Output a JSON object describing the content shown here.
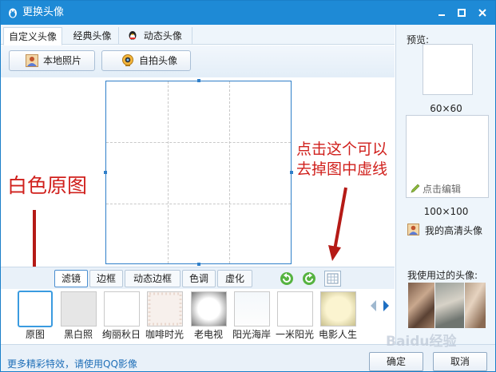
{
  "window": {
    "title": "更换头像",
    "controls": [
      "minimize",
      "maximize",
      "close"
    ]
  },
  "tabs": [
    {
      "label": "自定义头像",
      "active": true
    },
    {
      "label": "经典头像",
      "active": false
    },
    {
      "label": "动态头像",
      "active": false
    }
  ],
  "actions": {
    "local_photo": "本地照片",
    "selfie": "自拍头像"
  },
  "annotations": {
    "left": "白色原图",
    "right_line1": "点击这个可以",
    "right_line2": "去掉图中虚线"
  },
  "filter_tabs": [
    {
      "label": "滤镜",
      "active": true
    },
    {
      "label": "边框",
      "active": false
    },
    {
      "label": "动态边框",
      "active": false
    },
    {
      "label": "色调",
      "active": false
    },
    {
      "label": "虚化",
      "active": false
    }
  ],
  "filters": [
    {
      "label": "原图",
      "selected": true
    },
    {
      "label": "黑白照"
    },
    {
      "label": "绚丽秋日"
    },
    {
      "label": "咖啡时光"
    },
    {
      "label": "老电视"
    },
    {
      "label": "阳光海岸"
    },
    {
      "label": "一米阳光"
    },
    {
      "label": "电影人生"
    }
  ],
  "bottom": {
    "more_effects": "更多精彩特效，请使用QQ影像",
    "confirm": "确定",
    "cancel": "取消"
  },
  "preview": {
    "title": "预览:",
    "size_small": "60×60",
    "edit_link": "点击编辑",
    "size_large": "100×100",
    "hd_avatar": "我的高清头像",
    "used_title": "我使用过的头像:"
  },
  "watermark": "Baidu经验",
  "colors": {
    "titlebar": "#1e8ad6",
    "annotation": "#d0201c",
    "accent": "#2f7fc9"
  }
}
